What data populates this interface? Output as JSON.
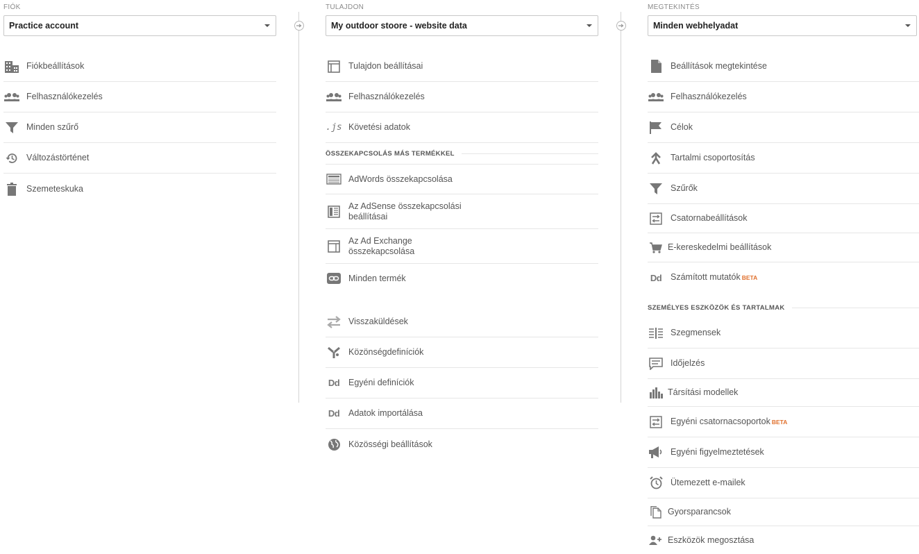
{
  "account": {
    "label": "FIÓK",
    "selected": "Practice account",
    "items": [
      {
        "label": "Fiókbeállítások",
        "icon": "building-icon"
      },
      {
        "label": "Felhasználókezelés",
        "icon": "users-icon"
      },
      {
        "label": "Minden szűrő",
        "icon": "filter-icon"
      },
      {
        "label": "Változástörténet",
        "icon": "history-icon"
      },
      {
        "label": "Szemeteskuka",
        "icon": "trash-icon"
      }
    ]
  },
  "property": {
    "label": "TULAJDON",
    "selected": "My outdoor stoore - website data",
    "items": [
      {
        "label": "Tulajdon beállításai",
        "icon": "window-icon"
      },
      {
        "label": "Felhasználókezelés",
        "icon": "users-icon"
      },
      {
        "label": "Követési adatok",
        "icon": "js-icon",
        "glyph": ".js"
      }
    ],
    "section_title": "ÖSSZEKAPCSOLÁS MÁS TERMÉKKEL",
    "linking_items": [
      {
        "label": "AdWords összekapcsolása",
        "icon": "adwords-icon"
      },
      {
        "label": "Az AdSense összekapcsolási beállításai",
        "icon": "adsense-icon"
      },
      {
        "label": "Az Ad Exchange összekapcsolása",
        "icon": "adexchange-icon"
      },
      {
        "label": "Minden termék",
        "icon": "link-icon"
      }
    ],
    "other_items": [
      {
        "label": "Visszaküldések",
        "icon": "postback-icon"
      },
      {
        "label": "Közönségdefiníciók",
        "icon": "audience-icon"
      },
      {
        "label": "Egyéni definíciók",
        "icon": "dd-icon",
        "glyph": "Dd"
      },
      {
        "label": "Adatok importálása",
        "icon": "dd-icon",
        "glyph": "Dd"
      },
      {
        "label": "Közösségi beállítások",
        "icon": "globe-icon"
      }
    ]
  },
  "view": {
    "label": "MEGTEKINTÉS",
    "selected": "Minden webhelyadat",
    "items": [
      {
        "label": "Beállítások megtekintése",
        "icon": "document-icon"
      },
      {
        "label": "Felhasználókezelés",
        "icon": "users-icon"
      },
      {
        "label": "Célok",
        "icon": "flag-icon"
      },
      {
        "label": "Tartalmi csoportosítás",
        "icon": "grouping-icon"
      },
      {
        "label": "Szűrők",
        "icon": "filter-icon"
      },
      {
        "label": "Csatornabeállítások",
        "icon": "channel-icon"
      },
      {
        "label": "E-kereskedelmi beállítások",
        "icon": "cart-icon"
      },
      {
        "label": "Számított mutatók",
        "icon": "dd-icon",
        "glyph": "Dd",
        "badge": "BETA"
      }
    ],
    "section_title": "SZEMÉLYES ESZKÖZÖK ÉS TARTALMAK",
    "personal_items": [
      {
        "label": "Szegmensek",
        "icon": "segments-icon"
      },
      {
        "label": "Időjelzés",
        "icon": "annotation-icon"
      },
      {
        "label": "Társítási modellek",
        "icon": "bar-chart-icon"
      },
      {
        "label": "Egyéni csatornacsoportok",
        "icon": "channel-icon",
        "badge": "BETA"
      },
      {
        "label": "Egyéni figyelmeztetések",
        "icon": "megaphone-icon"
      },
      {
        "label": "Ütemezett e-mailek",
        "icon": "alarm-icon"
      },
      {
        "label": "Gyorsparancsok",
        "icon": "copy-icon"
      },
      {
        "label": "Eszközök megosztása",
        "icon": "add-user-icon"
      }
    ]
  },
  "colors": {
    "accent_beta": "#e0702d",
    "text": "#555555",
    "divider": "#e6e6e6"
  }
}
